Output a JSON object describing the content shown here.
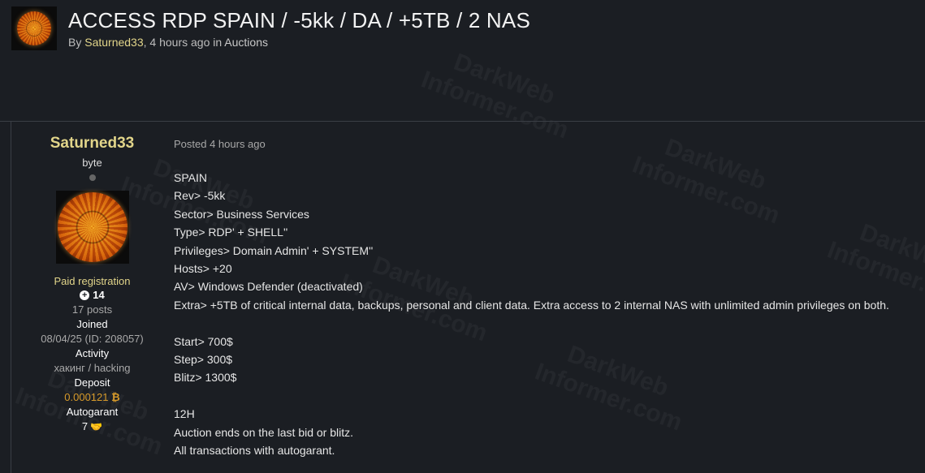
{
  "thread": {
    "title": "ACCESS RDP SPAIN / -5kk / DA / +5TB / 2 NAS",
    "by_prefix": "By ",
    "author": "Saturned33",
    "time": ", 4 hours ago in ",
    "category": "Auctions"
  },
  "user": {
    "name": "Saturned33",
    "rank": "byte",
    "group": "Paid registration",
    "reputation": "14",
    "posts": "17 posts",
    "joined_label": "Joined",
    "joined_value": "08/04/25 (ID: 208057)",
    "activity_label": "Activity",
    "activity_value": "хакинг / hacking",
    "deposit_label": "Deposit",
    "deposit_value": "0.000121",
    "autogarant_label": "Autogarant",
    "autogarant_value": "7"
  },
  "post": {
    "posted": "Posted 4 hours ago",
    "lines_a": [
      "SPAIN",
      "Rev> -5kk",
      "Sector> Business Services",
      "Type> RDP' + SHELL''",
      "Privileges> Domain Admin' + SYSTEM''",
      "Hosts> +20",
      "AV> Windows Defender (deactivated)",
      "Extra>  +5TB of critical internal data, backups, personal and client data. Extra access to 2 internal NAS with unlimited admin privileges on both."
    ],
    "lines_b": [
      "Start>  700$",
      "Step>  300$",
      "Blitz> 1300$"
    ],
    "lines_c": [
      "12H",
      "Auction ends on the last bid or blitz.",
      "All transactions with autogarant."
    ]
  },
  "watermark": {
    "line1": "DarkWeb",
    "line2": "Informer.com"
  },
  "colors": {
    "background": "#1b1e23",
    "username": "#e2d58a",
    "deposit": "#d89b2a"
  },
  "icons": [
    "plus-circle-icon",
    "bitcoin-icon",
    "handshake-icon"
  ]
}
